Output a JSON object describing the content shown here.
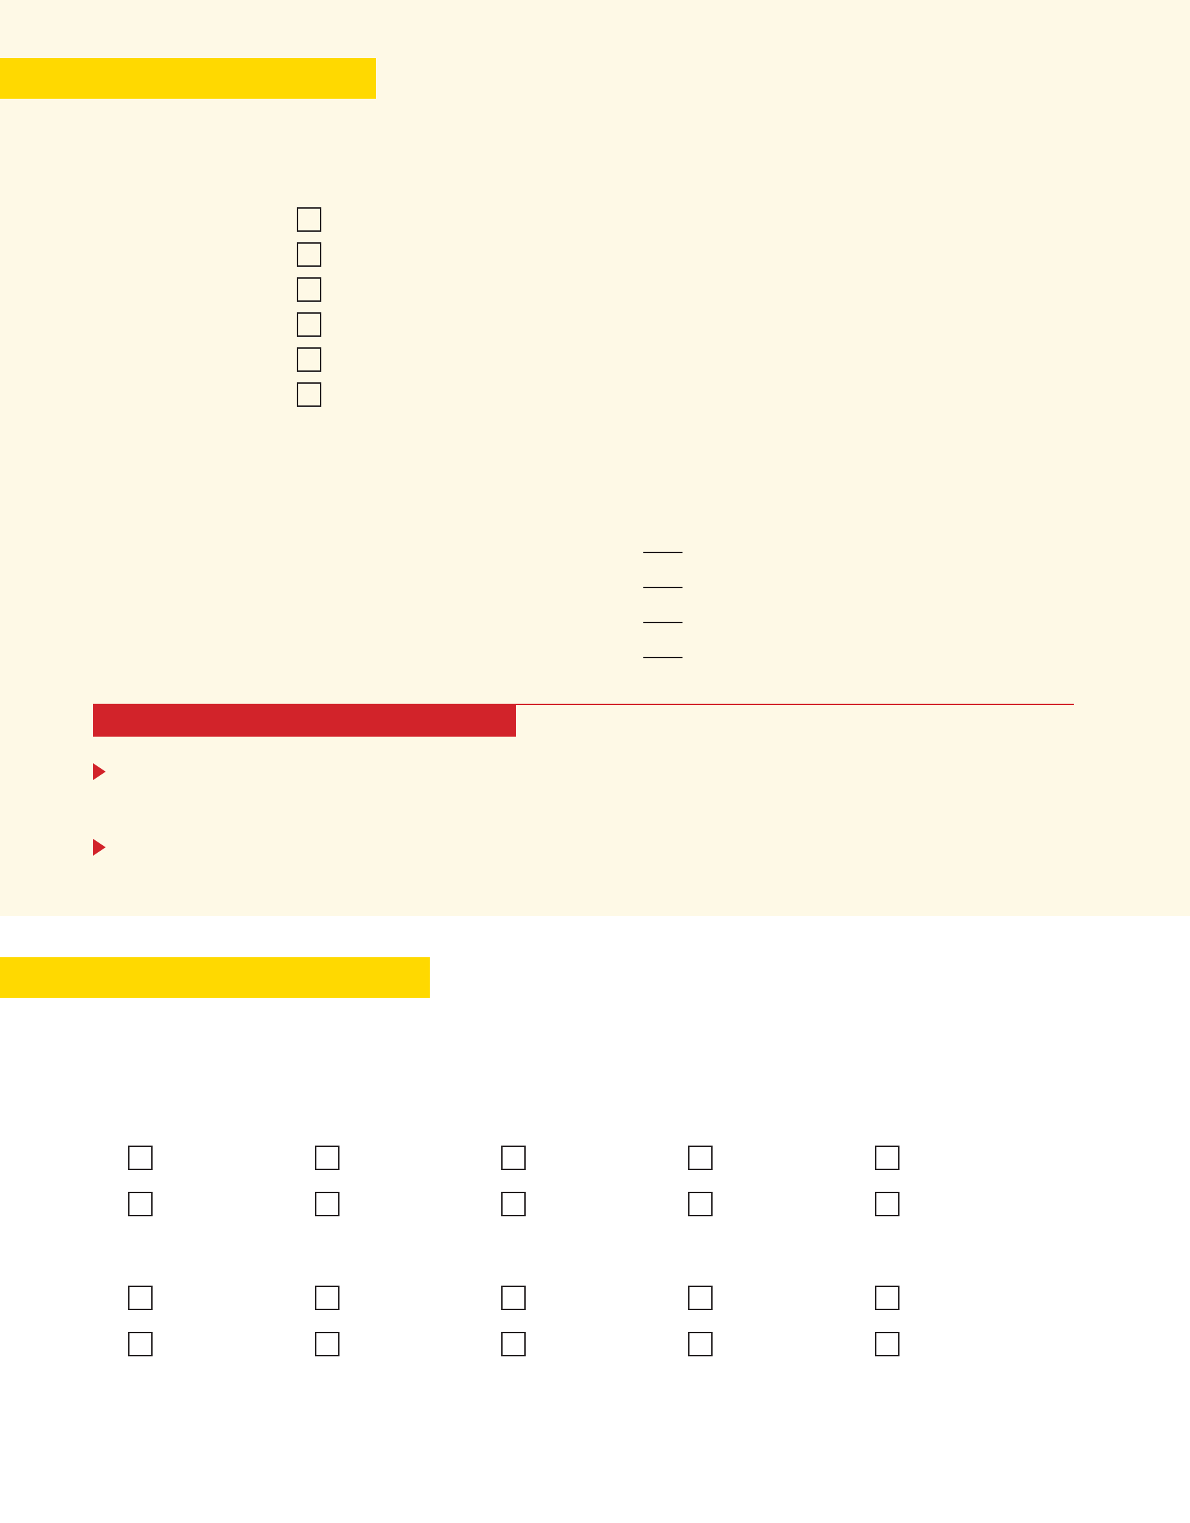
{
  "colors": {
    "panel_background": "#fef9e6",
    "highlight_bar": "#ffd900",
    "accent_red": "#d2232a",
    "ink": "#231f20"
  },
  "section_one": {
    "checklist": {
      "checked": [
        false,
        false,
        false,
        false,
        false,
        false
      ]
    },
    "fill_in_blanks": {
      "values": [
        "",
        "",
        "",
        ""
      ]
    },
    "bullet_icon": "triangle-right-icon",
    "bullets": [
      "",
      ""
    ]
  },
  "section_two": {
    "checkbox_grid": {
      "checked": [
        [
          false,
          false,
          false,
          false,
          false
        ],
        [
          false,
          false,
          false,
          false,
          false
        ],
        [
          false,
          false,
          false,
          false,
          false
        ],
        [
          false,
          false,
          false,
          false,
          false
        ]
      ]
    }
  }
}
